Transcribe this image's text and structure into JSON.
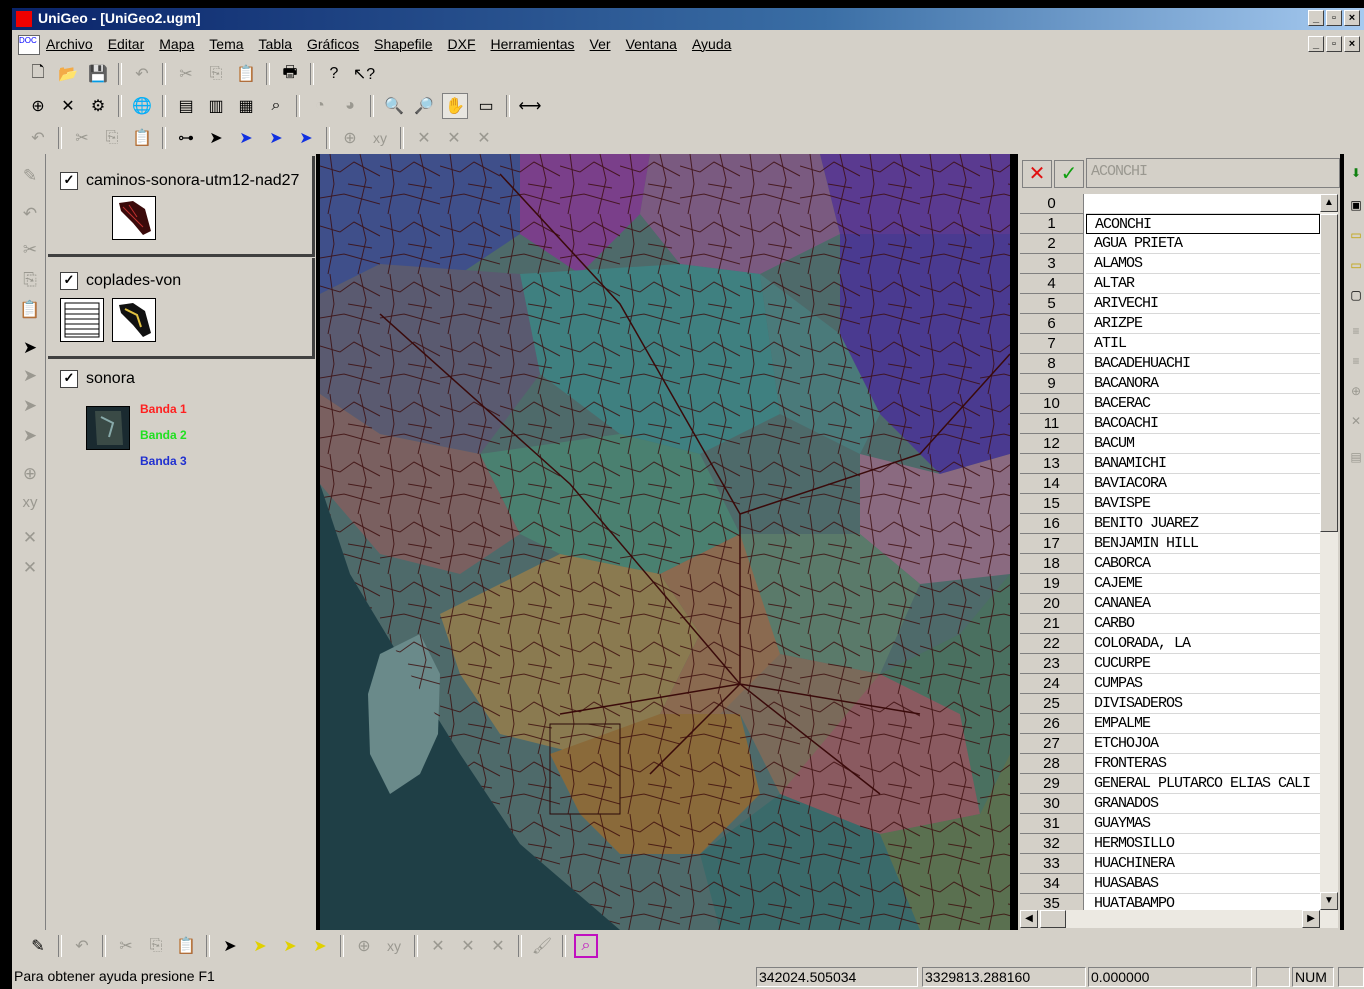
{
  "window": {
    "title": "UniGeo - [UniGeo2.ugm]"
  },
  "menu": [
    "Archivo",
    "Editar",
    "Mapa",
    "Tema",
    "Tabla",
    "Gráficos",
    "Shapefile",
    "DXF",
    "Herramientas",
    "Ver",
    "Ventana",
    "Ayuda"
  ],
  "layers": [
    {
      "name": "caminos-sonora-utm12-nad27",
      "checked": "✓"
    },
    {
      "name": "coplades-von",
      "checked": "✓"
    },
    {
      "name": "sonora",
      "checked": "✓",
      "bands": [
        "Banda 1",
        "Banda 2",
        "Banda 3"
      ]
    }
  ],
  "band_colors": [
    "#ff2020",
    "#20e020",
    "#2030d0"
  ],
  "table": {
    "edit_value": "ACONCHI",
    "rows": [
      {
        "n": "0",
        "v": ""
      },
      {
        "n": "1",
        "v": "ACONCHI"
      },
      {
        "n": "2",
        "v": "AGUA PRIETA"
      },
      {
        "n": "3",
        "v": "ALAMOS"
      },
      {
        "n": "4",
        "v": "ALTAR"
      },
      {
        "n": "5",
        "v": "ARIVECHI"
      },
      {
        "n": "6",
        "v": "ARIZPE"
      },
      {
        "n": "7",
        "v": "ATIL"
      },
      {
        "n": "8",
        "v": "BACADEHUACHI"
      },
      {
        "n": "9",
        "v": "BACANORA"
      },
      {
        "n": "10",
        "v": "BACERAC"
      },
      {
        "n": "11",
        "v": "BACOACHI"
      },
      {
        "n": "12",
        "v": "BACUM"
      },
      {
        "n": "13",
        "v": "BANAMICHI"
      },
      {
        "n": "14",
        "v": "BAVIACORA"
      },
      {
        "n": "15",
        "v": "BAVISPE"
      },
      {
        "n": "16",
        "v": "BENITO JUAREZ"
      },
      {
        "n": "17",
        "v": "BENJAMIN HILL"
      },
      {
        "n": "18",
        "v": "CABORCA"
      },
      {
        "n": "19",
        "v": "CAJEME"
      },
      {
        "n": "20",
        "v": "CANANEA"
      },
      {
        "n": "21",
        "v": "CARBO"
      },
      {
        "n": "22",
        "v": "COLORADA, LA"
      },
      {
        "n": "23",
        "v": "CUCURPE"
      },
      {
        "n": "24",
        "v": "CUMPAS"
      },
      {
        "n": "25",
        "v": "DIVISADEROS"
      },
      {
        "n": "26",
        "v": "EMPALME"
      },
      {
        "n": "27",
        "v": "ETCHOJOA"
      },
      {
        "n": "28",
        "v": "FRONTERAS"
      },
      {
        "n": "29",
        "v": "GENERAL PLUTARCO ELIAS CALI"
      },
      {
        "n": "30",
        "v": "GRANADOS"
      },
      {
        "n": "31",
        "v": "GUAYMAS"
      },
      {
        "n": "32",
        "v": "HERMOSILLO"
      },
      {
        "n": "33",
        "v": "HUACHINERA"
      },
      {
        "n": "34",
        "v": "HUASABAS"
      },
      {
        "n": "35",
        "v": "HUATABAMPO"
      }
    ]
  },
  "status": {
    "help": "Para obtener ayuda presione F1",
    "x": "342024.505034",
    "y": "3329813.288160",
    "z": "0.000000",
    "num": "NUM"
  }
}
